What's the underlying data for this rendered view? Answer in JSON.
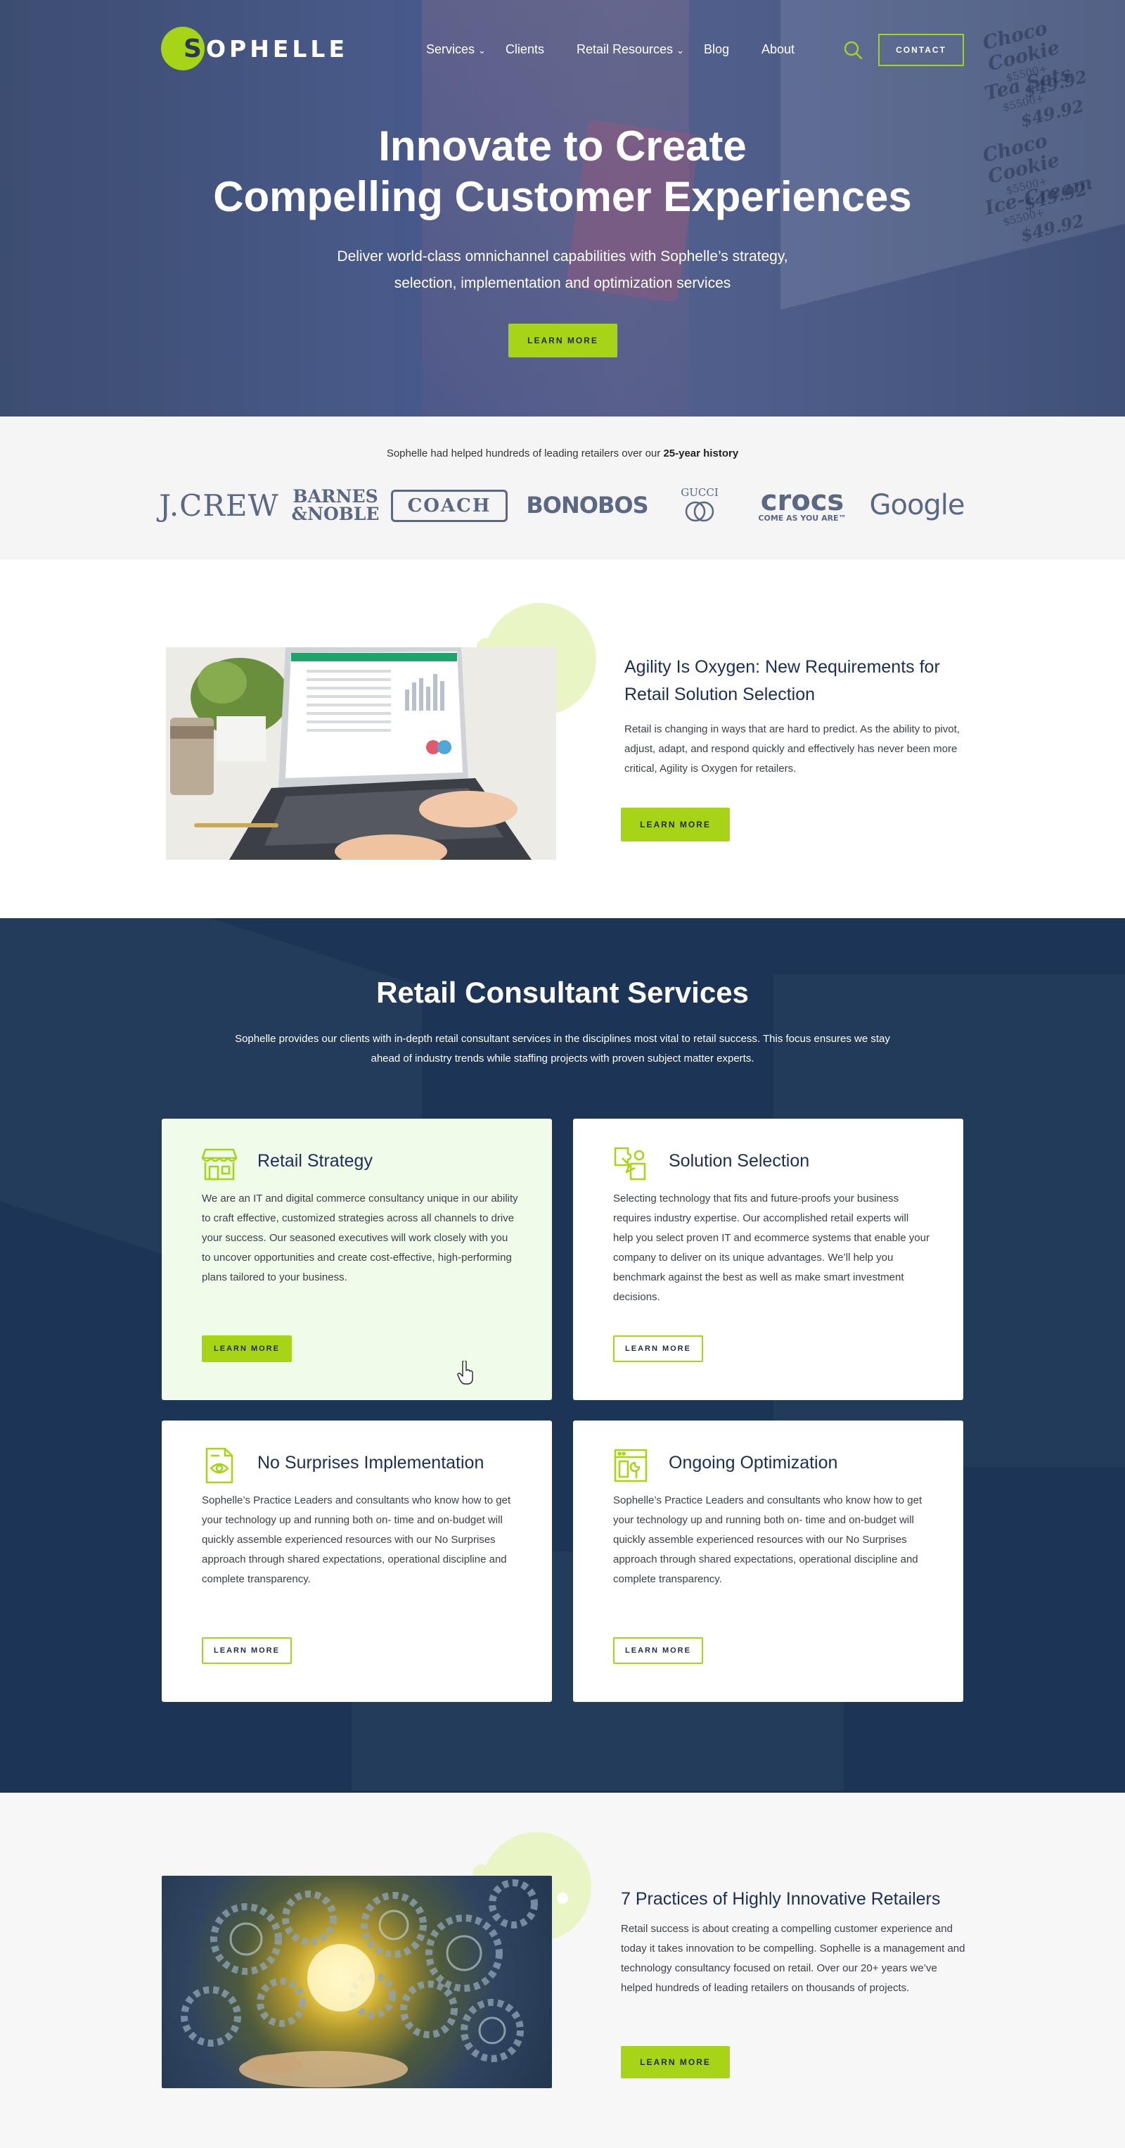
{
  "brand": {
    "logo_letter": "S",
    "logo_text": "OPHELLE",
    "accent": "#a8d417",
    "navy": "#1c2e58"
  },
  "header": {
    "nav": [
      {
        "label": "Services",
        "has_dropdown": true
      },
      {
        "label": "Clients",
        "has_dropdown": false
      },
      {
        "label": "Retail Resources",
        "has_dropdown": true
      },
      {
        "label": "Blog",
        "has_dropdown": false
      },
      {
        "label": "About",
        "has_dropdown": false
      }
    ],
    "search_icon": "search-icon",
    "contact_label": "CONTACT"
  },
  "hero": {
    "title_line1": "Innovate to Create",
    "title_line2": "Compelling Customer Experiences",
    "subtitle_line1": "Deliver world-class omnichannel capabilities with Sophelle’s strategy,",
    "subtitle_line2": "selection, implementation and optimization services",
    "button_label": "LEARN MORE",
    "signs": [
      {
        "name": "Choco Cookie",
        "sub": "$5500+",
        "price": "$49.92"
      },
      {
        "name": "Tea Sets",
        "sub": "$5500+",
        "price": "$49.92"
      },
      {
        "name": "Choco Cookie",
        "sub": "$5500+",
        "price": "$49.92"
      },
      {
        "name": "Ice-Cream",
        "sub": "$5500+",
        "price": "$49.92"
      }
    ]
  },
  "clients": {
    "intro_prefix": "Sophelle had helped hundreds of leading retailers over our ",
    "intro_bold": "25-year history",
    "logos": {
      "jcrew": "J.CREW",
      "barnes_line1": "BARNES",
      "barnes_line2": "&NOBLE",
      "coach": "COACH",
      "bonobos": "BONOBOS",
      "gucci": "GUCCI",
      "crocs": "crocs",
      "crocs_tagline": "COME AS YOU ARE™",
      "google": "Google"
    }
  },
  "agility": {
    "title_line1": "Agility Is Oxygen: New Requirements for",
    "title_line2": "Retail Solution Selection",
    "text": "Retail is changing in ways that are hard to predict. As the ability to pivot, adjust, adapt, and respond quickly and effectively has never been more critical, Agility is Oxygen for retailers.",
    "button_label": "LEARN MORE"
  },
  "services": {
    "title": "Retail Consultant Services",
    "subtitle": "Sophelle provides our clients with in-depth retail consultant services in the disciplines most vital to retail success. This focus ensures we stay ahead of industry trends while staffing projects with proven subject matter experts.",
    "cards": [
      {
        "title": "Retail Strategy",
        "icon": "storefront-icon",
        "text": "We are an IT and digital commerce consultancy unique in our ability to craft effective, customized strategies across all channels to drive your success. Our seasoned executives will work closely with you to uncover opportunities and create cost-effective, high-performing plans tailored to your business.",
        "button": "LEARN MORE"
      },
      {
        "title": "Solution Selection",
        "icon": "puzzle-icon",
        "text": "Selecting technology that fits and future-proofs your business requires industry expertise. Our accomplished retail experts will help you select proven IT and ecommerce systems that enable your company to deliver on its unique advantages. We’ll help you benchmark against the best as well as make smart investment decisions.",
        "button": "LEARN MORE"
      },
      {
        "title": "No Surprises Implementation",
        "icon": "document-eye-icon",
        "text": "Sophelle’s Practice Leaders and consultants who know how to get your technology up and running both on- time and on-budget will quickly assemble experienced resources with our No Surprises approach through shared expectations, operational discipline and complete transparency.",
        "button": "LEARN MORE"
      },
      {
        "title": "Ongoing Optimization",
        "icon": "browser-wrench-icon",
        "text": "Sophelle’s Practice Leaders and consultants who know how to get your technology up and running both on- time and on-budget will quickly assemble experienced resources with our No Surprises approach through shared expectations, operational discipline and complete transparency.",
        "button": "LEARN MORE"
      }
    ]
  },
  "practices": {
    "title": "7 Practices of Highly Innovative Retailers",
    "text": "Retail success is about creating a compelling customer experience and today it takes innovation to be compelling. Sophelle is a management and technology consultancy focused on retail. Over our 20+ years we’ve helped hundreds of leading retailers on thousands of projects.",
    "button_label": "LEARN MORE"
  }
}
